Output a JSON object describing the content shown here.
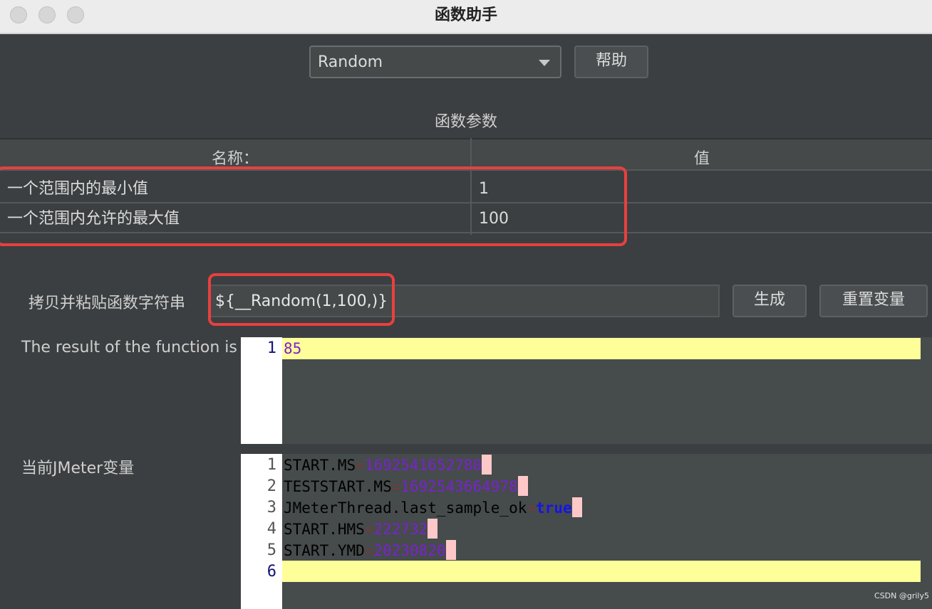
{
  "window": {
    "title": "函数助手"
  },
  "function_select": {
    "value": "Random",
    "help_label": "帮助"
  },
  "params": {
    "section_title": "函数参数",
    "columns": [
      "名称：",
      "值"
    ],
    "rows": [
      {
        "name": "一个范围内的最小值",
        "value": "1"
      },
      {
        "name": "一个范围内允许的最大值",
        "value": "100"
      }
    ]
  },
  "copy_row": {
    "label": "拷贝并粘贴函数字符串",
    "value": "${__Random(1,100,)}",
    "generate_label": "生成",
    "reset_label": "重置变量"
  },
  "result": {
    "label": "The result of the function is",
    "lines": [
      {
        "no": "1",
        "text": "85"
      }
    ]
  },
  "vars": {
    "label": "当前JMeter变量",
    "lines": [
      {
        "no": "1",
        "key": "START.MS",
        "eq": "=",
        "value": "1692541652780"
      },
      {
        "no": "2",
        "key": "TESTSTART.MS",
        "eq": "=",
        "value": "1692543664978"
      },
      {
        "no": "3",
        "key": "JMeterThread.last_sample_ok",
        "eq": "=",
        "value": "true"
      },
      {
        "no": "4",
        "key": "START.HMS",
        "eq": "=",
        "value": "222732"
      },
      {
        "no": "5",
        "key": "START.YMD",
        "eq": "=",
        "value": "20230820"
      },
      {
        "no": "6",
        "key": "",
        "eq": "",
        "value": ""
      }
    ]
  },
  "watermark": "CSDN @grily5",
  "colors": {
    "highlight_box": "#e8403f",
    "current_line": "#ffff99",
    "number": "#7a22cf",
    "keyword": "#1515e6"
  }
}
